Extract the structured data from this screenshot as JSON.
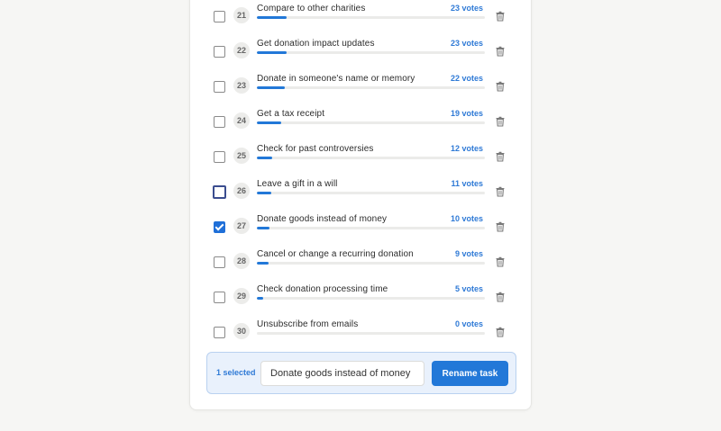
{
  "tasks": [
    {
      "rank": "21",
      "title": "Compare to other charities",
      "votes_label": "23 votes",
      "votes": 23,
      "checked": false,
      "focused": false
    },
    {
      "rank": "22",
      "title": "Get donation impact updates",
      "votes_label": "23 votes",
      "votes": 23,
      "checked": false,
      "focused": false
    },
    {
      "rank": "23",
      "title": "Donate in someone's name or memory",
      "votes_label": "22 votes",
      "votes": 22,
      "checked": false,
      "focused": false
    },
    {
      "rank": "24",
      "title": "Get a tax receipt",
      "votes_label": "19 votes",
      "votes": 19,
      "checked": false,
      "focused": false
    },
    {
      "rank": "25",
      "title": "Check for past controversies",
      "votes_label": "12 votes",
      "votes": 12,
      "checked": false,
      "focused": false
    },
    {
      "rank": "26",
      "title": "Leave a gift in a will",
      "votes_label": "11 votes",
      "votes": 11,
      "checked": false,
      "focused": true
    },
    {
      "rank": "27",
      "title": "Donate goods instead of money",
      "votes_label": "10 votes",
      "votes": 10,
      "checked": true,
      "focused": false
    },
    {
      "rank": "28",
      "title": "Cancel or change a recurring donation",
      "votes_label": "9 votes",
      "votes": 9,
      "checked": false,
      "focused": false
    },
    {
      "rank": "29",
      "title": "Check donation processing time",
      "votes_label": "5 votes",
      "votes": 5,
      "checked": false,
      "focused": false
    },
    {
      "rank": "30",
      "title": "Unsubscribe from emails",
      "votes_label": "0 votes",
      "votes": 0,
      "checked": false,
      "focused": false
    }
  ],
  "selection_bar": {
    "selected_label": "1 selected",
    "rename_value": "Donate goods instead of money",
    "rename_button_label": "Rename task"
  },
  "colors": {
    "accent": "#2278d8",
    "votes_text": "#2f7ad6",
    "selection_bg": "#e9f1fc"
  },
  "icons": {
    "delete": "trash-icon",
    "checked": "checkmark-icon"
  }
}
